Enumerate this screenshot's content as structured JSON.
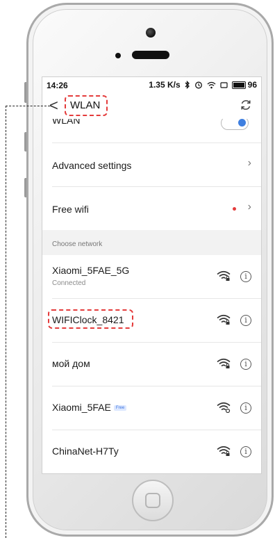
{
  "status_bar": {
    "time": "14:26",
    "speed": "1.35 K/s",
    "battery": "96"
  },
  "header": {
    "title": "WLAN",
    "back_glyph": "<",
    "refresh_icon": "refresh-icon"
  },
  "toggle_row": {
    "label": "WLAN",
    "enabled": true
  },
  "settings": {
    "advanced_label": "Advanced settings",
    "free_wifi_label": "Free wifi"
  },
  "section": {
    "choose_network_label": "Choose network"
  },
  "networks": [
    {
      "ssid": "Xiaomi_5FAE_5G",
      "status": "Connected",
      "badge": "",
      "lock": true
    },
    {
      "ssid": "WIFIClock_8421",
      "status": "",
      "badge": "",
      "lock": true
    },
    {
      "ssid": "мой дом",
      "status": "",
      "badge": "",
      "lock": true
    },
    {
      "ssid": "Xiaomi_5FAE",
      "status": "",
      "badge": "Free",
      "lock": false
    },
    {
      "ssid": "ChinaNet-H7Ty",
      "status": "",
      "badge": "",
      "lock": true
    }
  ],
  "colors": {
    "accent": "#3f7fe0",
    "annotation": "#e43b3b"
  }
}
